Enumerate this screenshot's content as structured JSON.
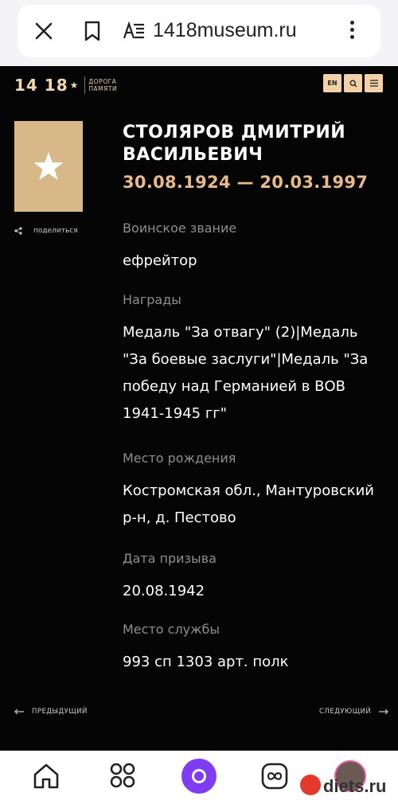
{
  "browser": {
    "url": "1418museum.ru"
  },
  "header": {
    "logo_num": "14 18",
    "logo_text_1": "ДОРОГА",
    "logo_text_2": "ПАМЯТИ",
    "lang_button": "EN"
  },
  "person": {
    "name": "СТОЛЯРОВ ДМИТРИЙ ВАСИЛЬЕВИЧ",
    "dates": "30.08.1924 — 20.03.1997",
    "share_label": "поделиться"
  },
  "fields": [
    {
      "label": "Воинское звание",
      "value": "ефрейтор"
    },
    {
      "label": "Награды",
      "value": "Медаль \"За отвагу\" (2)|Медаль \"За боевые заслуги\"|Медаль \"За победу над Германией в ВОВ 1941-1945 гг\""
    },
    {
      "label": "Место рождения",
      "value": "Костромская обл., Мантуровский р-н, д. Пестово"
    },
    {
      "label": "Дата призыва",
      "value": "20.08.1942"
    },
    {
      "label": "Место службы",
      "value": "993 сп 1303 арт. полк"
    }
  ],
  "pagination": {
    "prev": "ПРЕДЫДУЩИЙ",
    "next": "СЛЕДУЮЩИЙ"
  },
  "bottom_nav": {
    "watermark": "diets.ru"
  },
  "colors": {
    "accent": "#f0d2a6",
    "dates": "#e8b98a",
    "background": "#050505"
  }
}
